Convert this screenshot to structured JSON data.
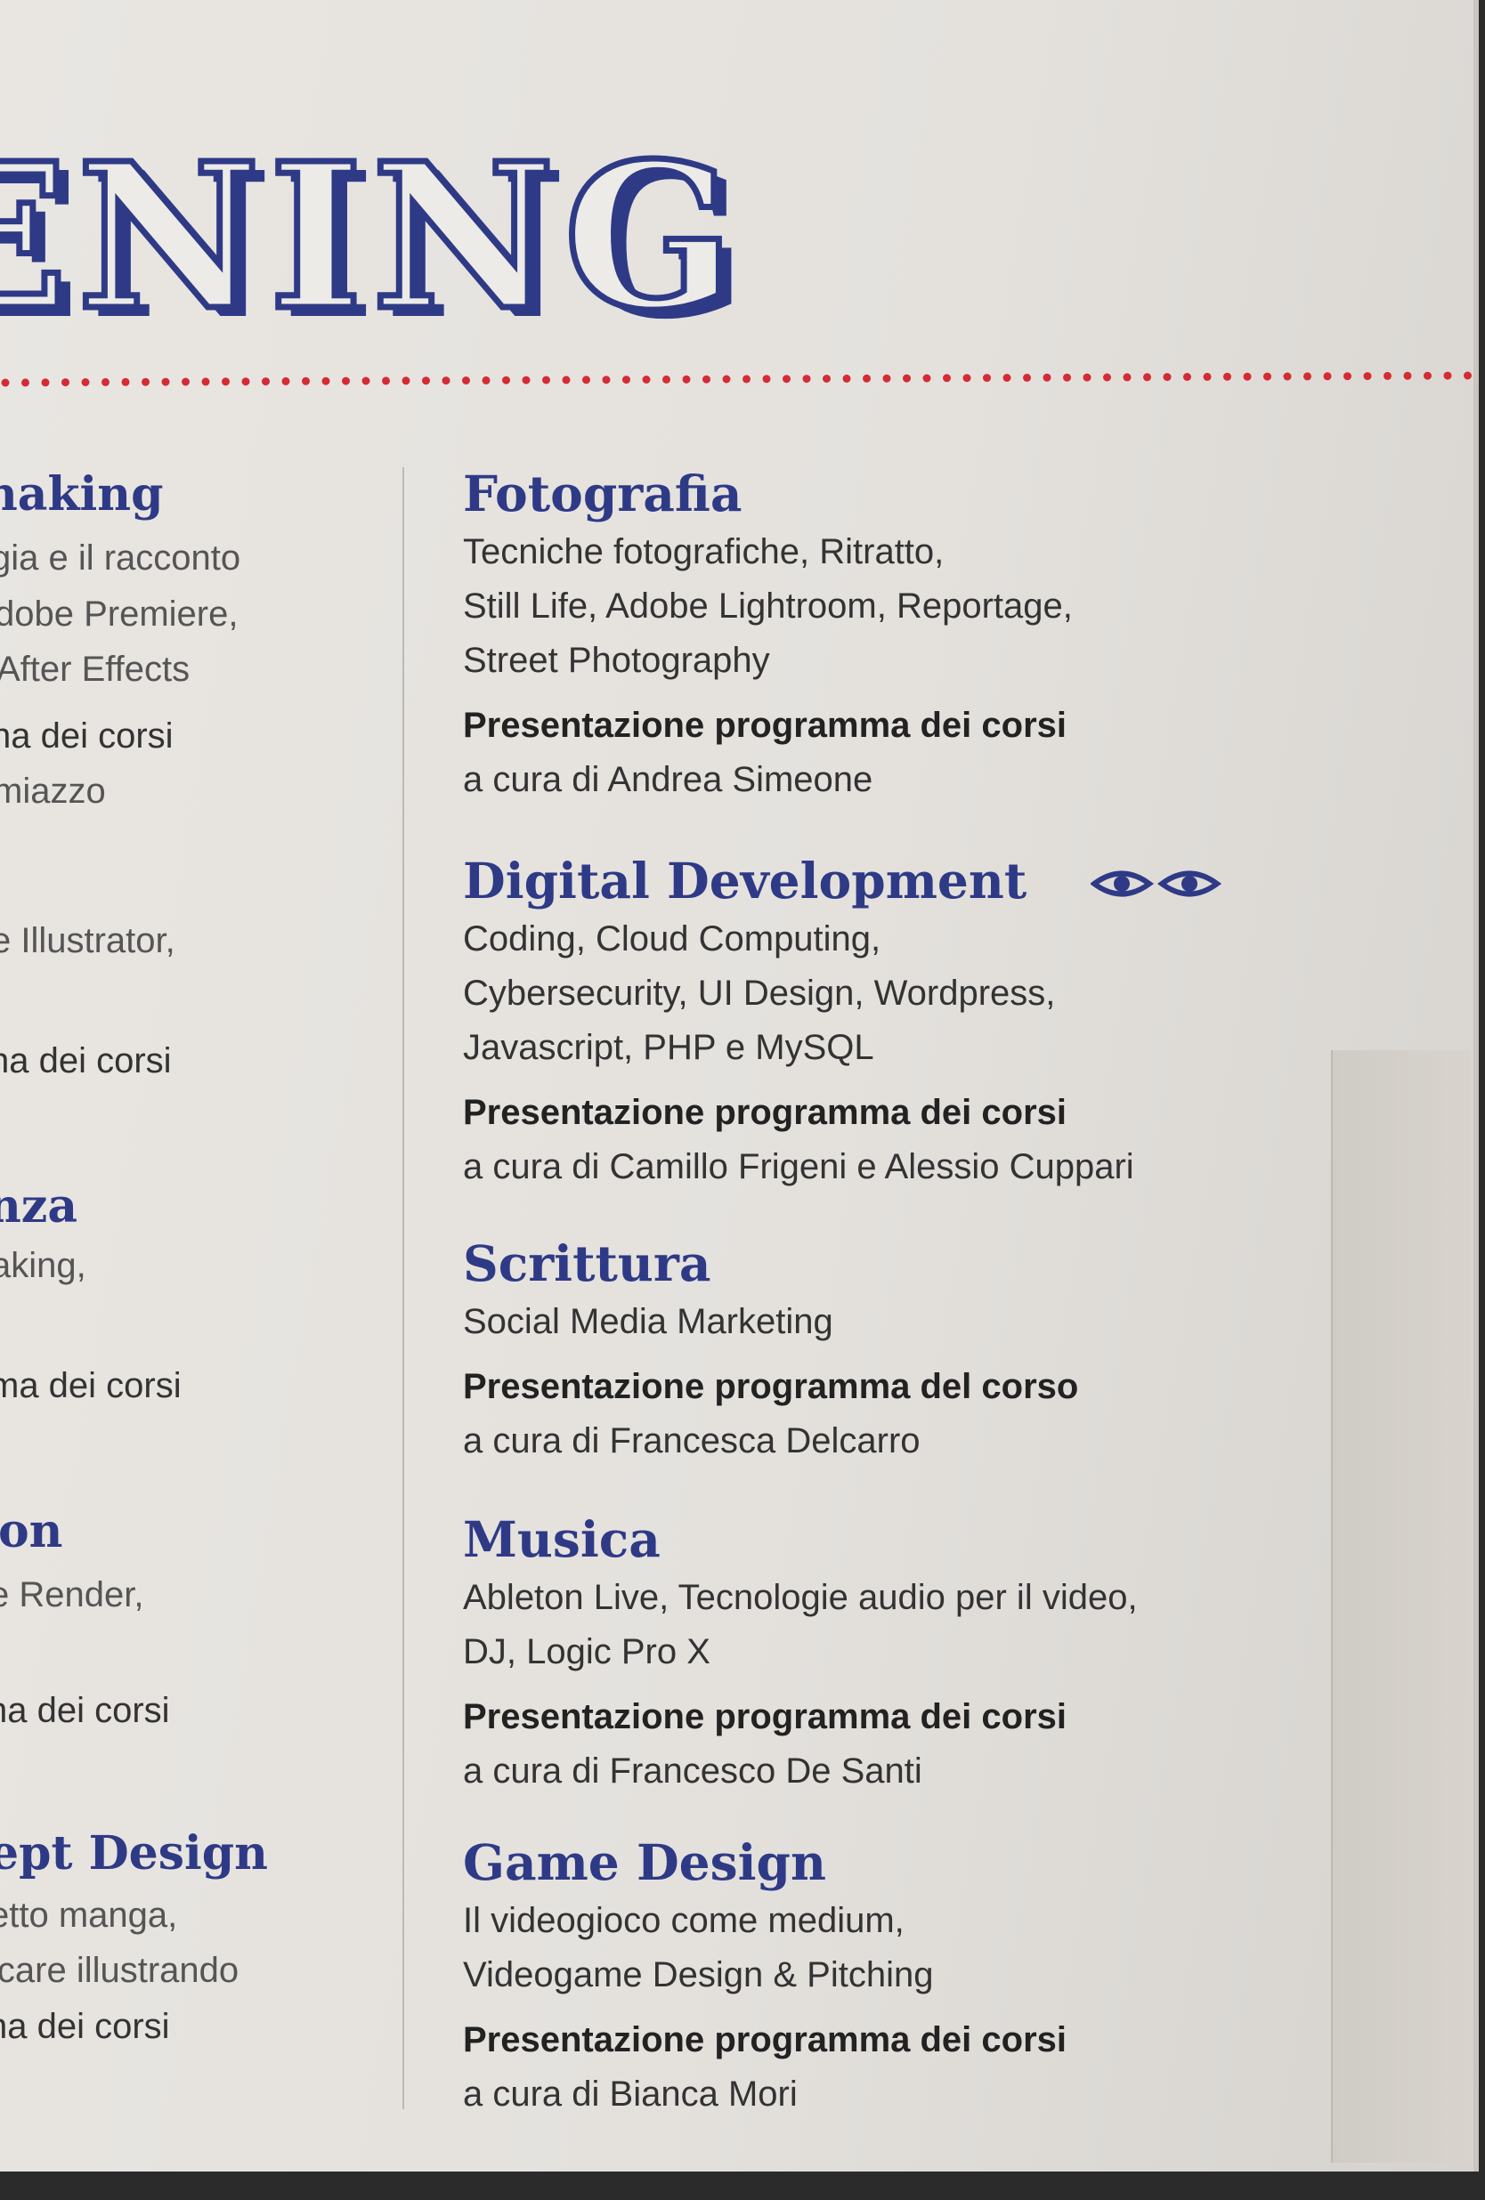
{
  "header": {
    "title": "ENING",
    "colors": {
      "blue": "#2f3a86",
      "dots": "#d42b35"
    }
  },
  "left_column": {
    "fragments": [
      "naking",
      "gia e il racconto",
      "dobe Premiere,",
      "After Effects",
      "ha dei corsi",
      "miazzo",
      "e Illustrator,",
      "ha dei corsi",
      "nza",
      "aking,",
      "ma dei corsi",
      "on",
      "e Render,",
      "na dei corsi",
      "ept Design",
      "etto manga,",
      "icare illustrando",
      "ha dei corsi"
    ]
  },
  "sections": [
    {
      "title": "Fotografia",
      "lines": [
        "Tecniche fotografiche, Ritratto,",
        "Still Life, Adobe Lightroom, Reportage,",
        "Street Photography"
      ],
      "presentation": "Presentazione programma dei corsi",
      "curator": "a cura di Andrea Simeone"
    },
    {
      "title": "Digital Development",
      "icons": [
        "eye-icon",
        "eye-icon"
      ],
      "lines": [
        "Coding, Cloud Computing,",
        "Cybersecurity, UI Design, Wordpress,",
        "Javascript, PHP e MySQL"
      ],
      "presentation": "Presentazione programma dei corsi",
      "curator": "a cura di Camillo Frigeni e Alessio Cuppari"
    },
    {
      "title": "Scrittura",
      "lines": [
        "Social Media Marketing"
      ],
      "presentation": "Presentazione programma del corso",
      "curator": "a cura di Francesca Delcarro"
    },
    {
      "title": "Musica",
      "lines": [
        "Ableton Live, Tecnologie audio per il video,",
        "DJ, Logic Pro X"
      ],
      "presentation": "Presentazione programma dei corsi",
      "curator": "a cura di Francesco De Santi"
    },
    {
      "title": "Game Design",
      "lines": [
        "Il videogioco come medium,",
        "Videogame Design & Pitching"
      ],
      "presentation": "Presentazione programma dei corsi",
      "curator": "a cura di Bianca Mori"
    }
  ]
}
